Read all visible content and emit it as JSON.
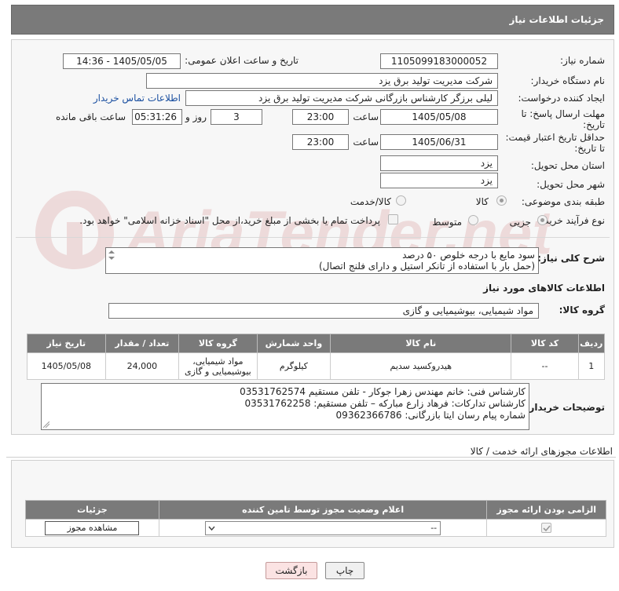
{
  "header": {
    "title": "جزئیات اطلاعات نیاز"
  },
  "fields": {
    "need_number": {
      "label": "شماره نیاز:",
      "value": "1105099183000052"
    },
    "announce_datetime": {
      "label": "تاریخ و ساعت اعلان عمومی:",
      "value": "1405/05/05 - 14:36"
    },
    "buyer_org": {
      "label": "نام دستگاه خریدار:",
      "value": "شرکت مدیریت تولید برق یزد"
    },
    "requester": {
      "label": "ایجاد کننده درخواست:",
      "value": "لیلی برزگر کارشناس بازرگانی شرکت مدیریت تولید برق یزد",
      "contact_link": "اطلاعات تماس خریدار"
    },
    "reply_deadline": {
      "label_line1": "مهلت ارسال پاسخ: تا",
      "label_line2": "تاریخ:",
      "date": "1405/05/08",
      "time_label": "ساعت",
      "time": "23:00",
      "days": "3",
      "days_label": "روز و",
      "remaining": "05:31:26",
      "remaining_label": "ساعت باقی مانده"
    },
    "min_price_validity": {
      "label_line1": "حداقل تاریخ اعتبار قیمت:",
      "label_line2": "تا تاریخ:",
      "date": "1405/06/31",
      "time_label": "ساعت",
      "time": "23:00"
    },
    "delivery_province": {
      "label": "استان محل تحویل:",
      "value": "یزد"
    },
    "delivery_city": {
      "label": "شهر محل تحویل:",
      "value": "یزد"
    },
    "category": {
      "label": "طبقه بندی موضوعی:",
      "options": [
        "کالا",
        "کالا/خدمت"
      ],
      "selected": "کالا"
    },
    "purchase_process": {
      "label": "نوع فرآیند خرید :",
      "options": [
        "جزیی",
        "متوسط"
      ],
      "selected": "جزیی",
      "payment_note": "پرداخت تمام یا بخشی از مبلغ خرید،از محل \"اسناد خزانه اسلامی\" خواهد بود."
    },
    "description": {
      "label": "شرح کلی نیاز:",
      "line1": "سود مایع با درجه خلوص ۵۰ درصد",
      "line2": "(حمل بار با استفاده از تانکر استیل و دارای فلنج اتصال)"
    }
  },
  "goods_section": {
    "title": "اطلاعات کالاهای مورد نیاز",
    "group_label": "گروه کالا:",
    "group_value": "مواد شیمیایی، بیوشیمیایی و گازی",
    "columns": [
      "ردیف",
      "کد کالا",
      "نام کالا",
      "واحد شمارش",
      "گروه کالا",
      "تعداد / مقدار",
      "تاریخ نیاز"
    ],
    "rows": [
      {
        "row": "1",
        "code": "--",
        "name": "هیدروکسید سدیم",
        "unit": "کیلوگرم",
        "group_line1": "مواد شیمیایی،",
        "group_line2": "بیوشیمیایی و گازی",
        "qty": "24,000",
        "date": "1405/05/08"
      }
    ]
  },
  "buyer_notes": {
    "label": "توضیحات خریدار:",
    "line1": "کارشناس فنی: خانم مهندس زهرا جوکار - تلفن مستقیم 03531762574",
    "line2": "کارشناس تدارکات: فرهاد زارع مبارکه –  تلفن مستقیم: 03531762258",
    "line3": "شماره پیام رسان ایتا بازرگانی: 09362366786"
  },
  "permits": {
    "title": "اطلاعات مجوزهای ارائه خدمت / کالا",
    "columns": [
      "الزامی بودن ارائه مجوز",
      "اعلام وضعیت مجوز توسط تامین کننده",
      "جزئیات"
    ],
    "select_value": "--",
    "view_button": "مشاهده مجوز"
  },
  "footer": {
    "print_button": "چاپ",
    "back_button": "بازگشت"
  },
  "watermark": {
    "text": "AriaTender.net"
  }
}
